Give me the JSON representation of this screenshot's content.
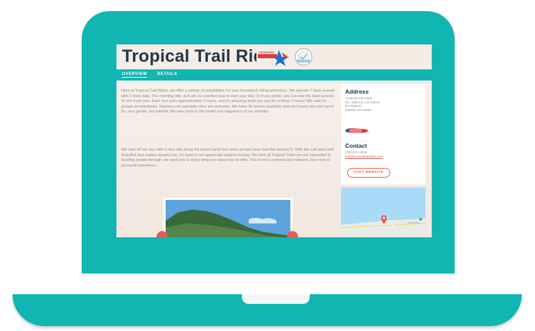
{
  "site": {
    "title": "Tropical Trail Rides"
  },
  "tabs": [
    {
      "label": "OVERVIEW",
      "active": true
    },
    {
      "label": "DETAILS",
      "active": false
    }
  ],
  "overview": {
    "paragraphs": [
      "Here at Tropical Trail Rides, we offer a variety of possibilities for your horseback riding adventure. We operate 7 days a week with 2 rides daily. The morning ride, at 8 am, is a perfect way to start your day. Or if you prefer, you can see the best sunsets on the 4 pm tour. Each tour lasts approximately 2 hours, and it's amazing what you can do in those 2 hours! We cater to groups or individuals. Inquiries into specialty rides are welcome. We have 30 horses available and our horses are well cared for, very gentle, but spirited! We take pride in the health and happiness of our animals.",
      "We start off our tour with a nice ride along the beach (and how many people have had that fantasy?). With the soft sand and beautiful blue waters around you, it's hard to not appreciate natures beauty. We here at Tropical Trails are not interested in bustling people through, we want you to enjoy what our island has to offer. This is not a commercial endeavor, but more of personal experience."
    ]
  },
  "sidebar": {
    "address_heading": "Address",
    "address_lines": [
      "Tropical Trail Rides",
      "Rd. 4466 Km 1.8 Interior",
      "Bo. Bajuras",
      "Isabela, PR 00662"
    ],
    "contact_heading": "Contact",
    "phone": "(787) 872-9256",
    "email": "info@tropicaltrailrides.com",
    "website_button": "VISIT WEBSITE"
  },
  "colors": {
    "laptop": "#10b6b1",
    "title": "#243746",
    "accent": "#e65b4d",
    "page_background": "#f4ece6"
  },
  "icons": [
    "puerto-rico-tourism-logo",
    "certification-badge",
    "puerto-rico-flag-icon",
    "map-pin-icon",
    "chevron-left-icon",
    "chevron-right-icon"
  ]
}
